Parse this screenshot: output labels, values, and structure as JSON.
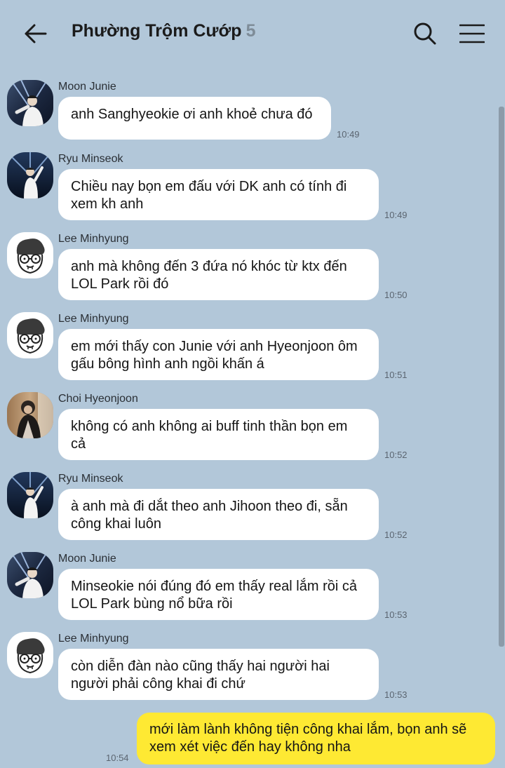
{
  "header": {
    "title": "Phường Trộm Cướp",
    "member_count": "5"
  },
  "messages": [
    {
      "sender": "Moon Junie",
      "avatar": "avatar-moon-junie",
      "text": "anh Sanghyeokie ơi anh khoẻ chưa đó",
      "time": "10:49"
    },
    {
      "sender": "Ryu Minseok",
      "avatar": "avatar-ryu-minseok",
      "text": "Chiều nay bọn em đấu với DK anh có tính đi xem kh anh",
      "time": "10:49"
    },
    {
      "sender": "Lee Minhyung",
      "avatar": "avatar-lee-minhyung",
      "text": "anh mà không đến 3 đứa nó khóc từ ktx đến LOL Park rồi đó",
      "time": "10:50"
    },
    {
      "sender": "Lee Minhyung",
      "avatar": "avatar-lee-minhyung",
      "text": "em mới thấy con Junie với anh Hyeonjoon ôm gấu bông hình anh ngồi khấn á",
      "time": "10:51"
    },
    {
      "sender": "Choi Hyeonjoon",
      "avatar": "avatar-choi-hyeonjoon",
      "text": "không có anh không ai buff tinh thần bọn em cả",
      "time": "10:52"
    },
    {
      "sender": "Ryu Minseok",
      "avatar": "avatar-ryu-minseok",
      "text": "à anh mà đi dắt theo anh Jihoon theo đi, sẵn công khai luôn",
      "time": "10:52"
    },
    {
      "sender": "Moon Junie",
      "avatar": "avatar-moon-junie",
      "text": "Minseokie nói đúng đó em thấy real lắm rồi cả LOL Park bùng nổ bữa rồi",
      "time": "10:53"
    },
    {
      "sender": "Lee Minhyung",
      "avatar": "avatar-lee-minhyung",
      "text": "còn diễn đàn nào cũng thấy hai người hai người phải công khai đi chứ",
      "time": "10:53"
    }
  ],
  "my_message": {
    "text": "mới làm lành không tiện công khai lắm, bọn anh sẽ xem xét việc đến hay không nha",
    "time": "10:54"
  },
  "colors": {
    "background": "#b2c7d9",
    "incoming_bubble": "#ffffff",
    "outgoing_bubble": "#fee933",
    "member_count": "#7e8c98"
  }
}
